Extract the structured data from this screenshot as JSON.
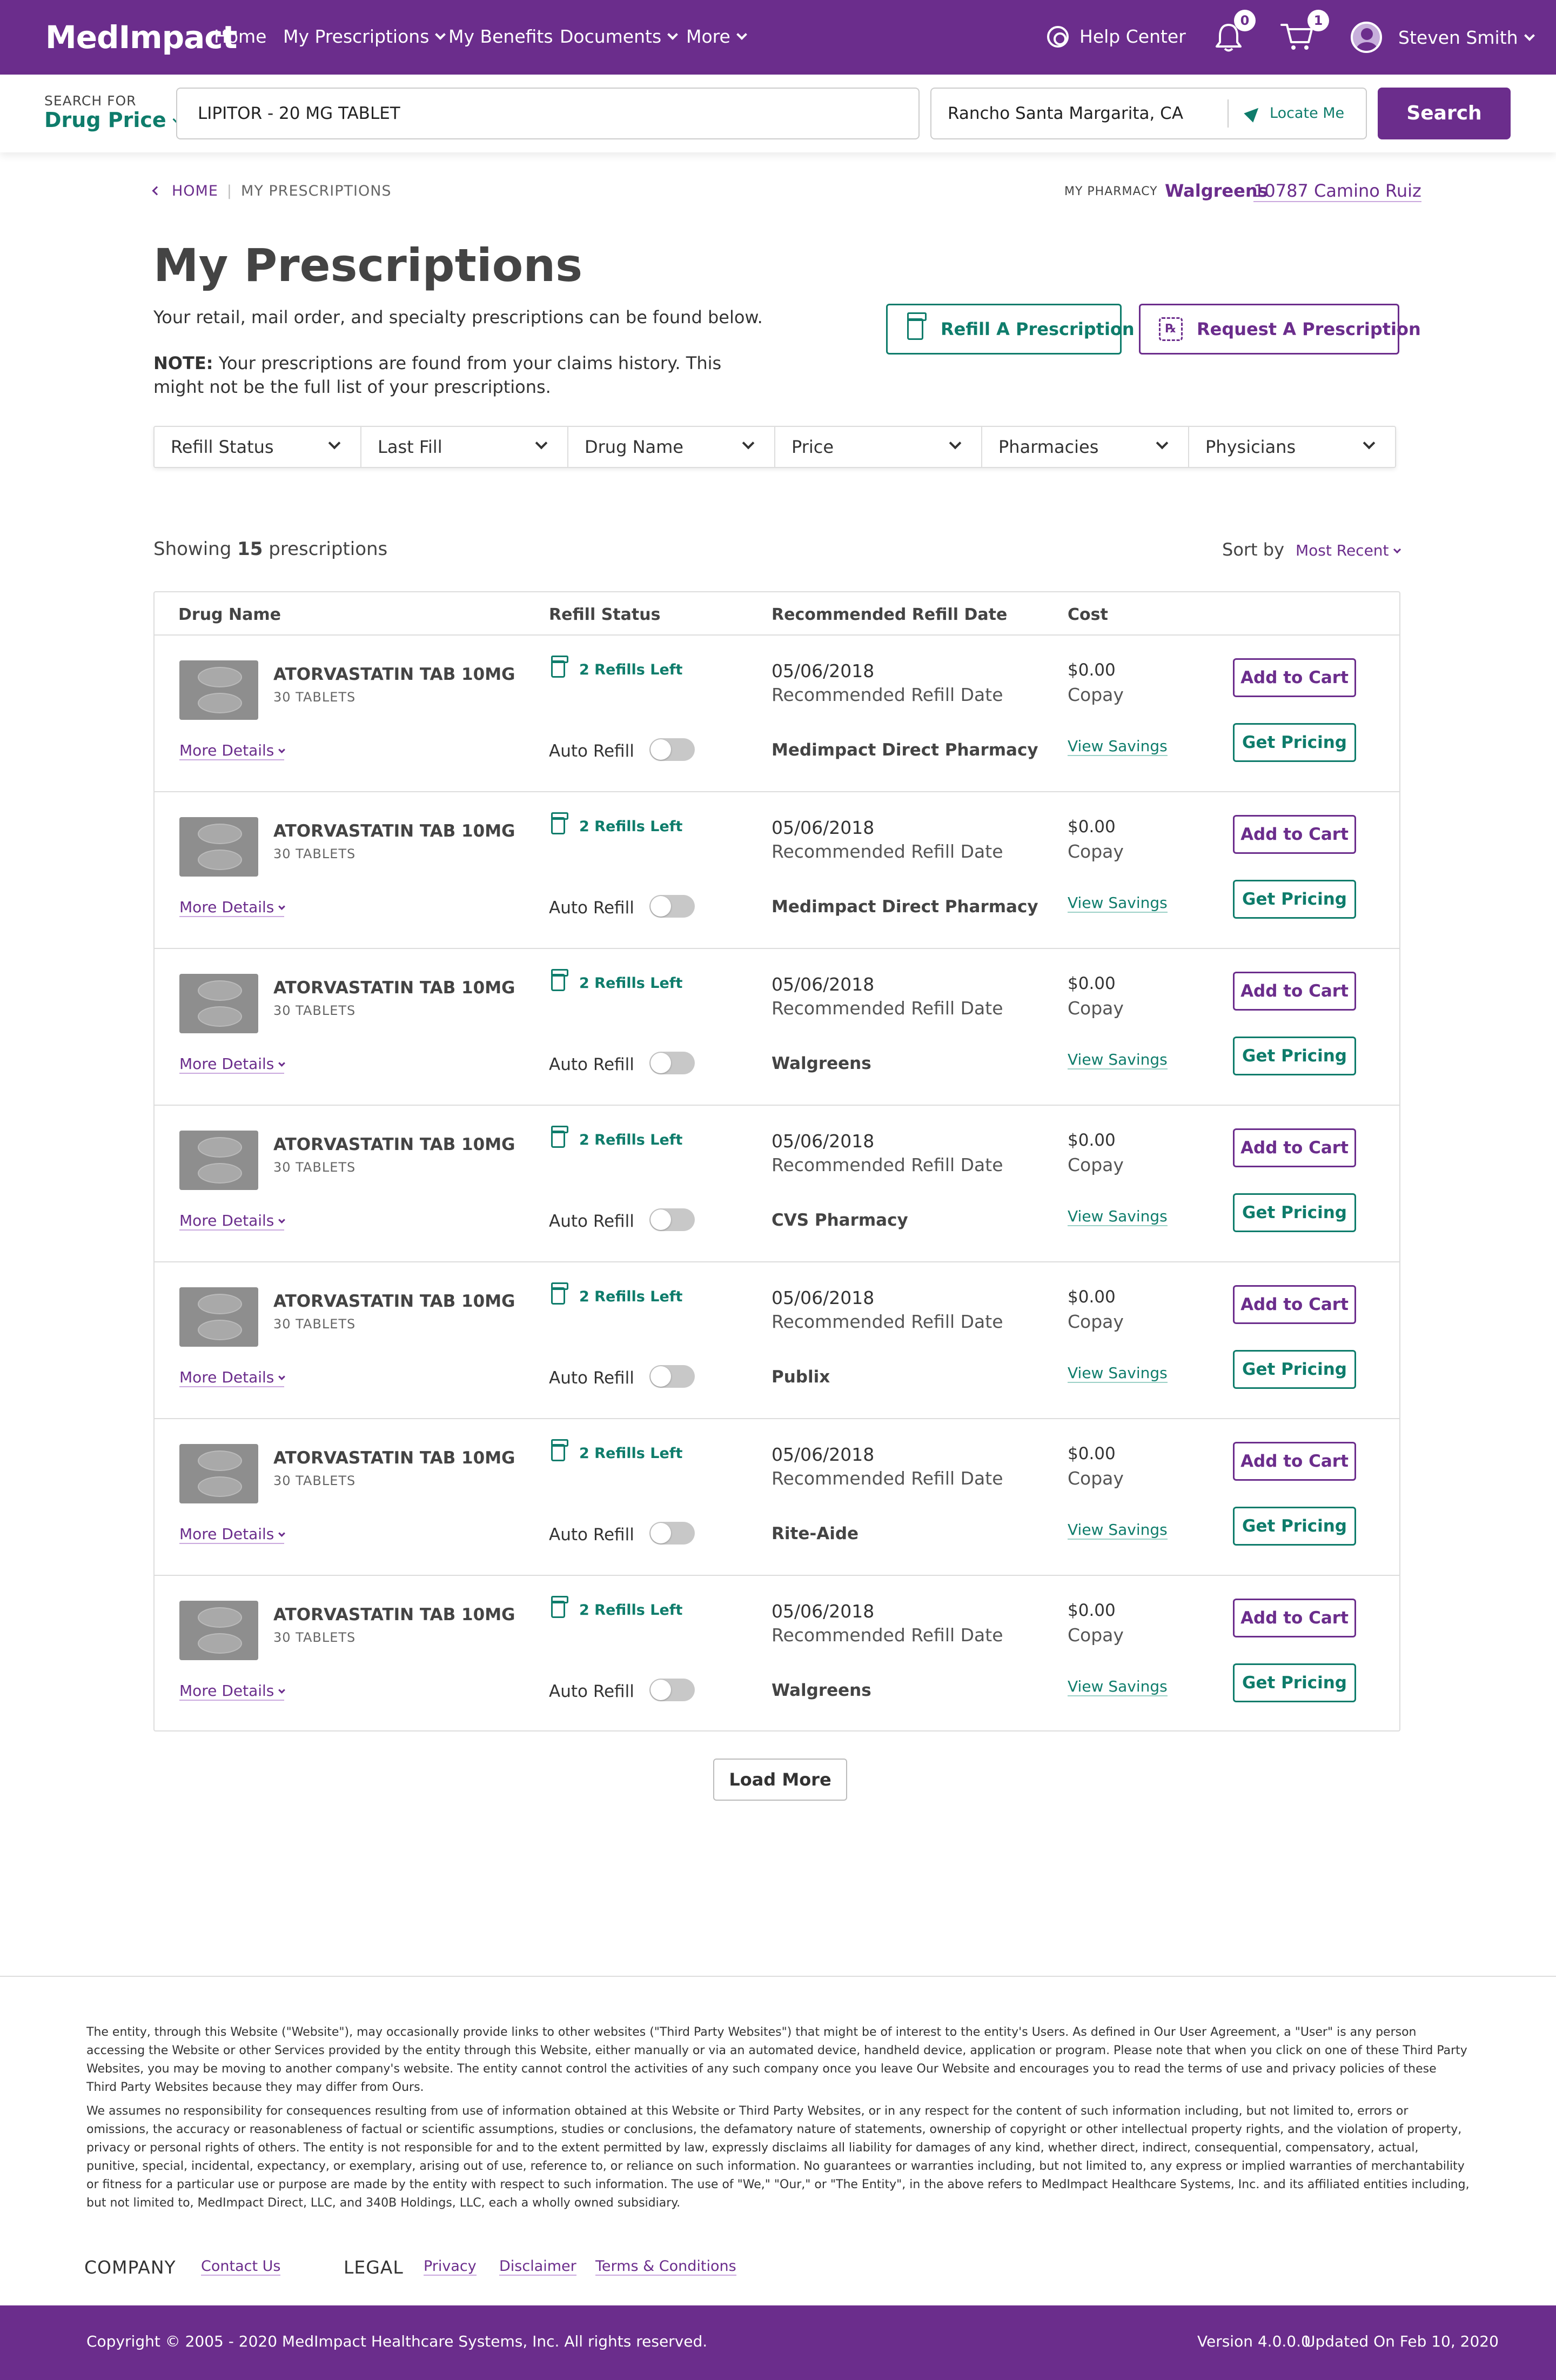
{
  "header": {
    "logo": "MedImpact",
    "nav": [
      "Home",
      "My Prescriptions",
      "My Benefits",
      "Documents",
      "More"
    ],
    "help_center": "Help Center",
    "notifications_count": "0",
    "cart_count": "1",
    "user_name": "Steven Smith"
  },
  "search": {
    "for_label": "SEARCH FOR",
    "for_value": "Drug Price",
    "drug_value": "LIPITOR - 20 MG TABLET",
    "location_value": "Rancho Santa Margarita, CA",
    "locate_me": "Locate Me",
    "button": "Search"
  },
  "breadcrumb": {
    "home": "HOME",
    "current": "MY PRESCRIPTIONS"
  },
  "pharmacy": {
    "label": "MY PHARMACY",
    "name": "Walgreens",
    "address": "10787 Camino Ruiz"
  },
  "page": {
    "title": "My Prescriptions",
    "intro": "Your retail, mail order, and specialty prescriptions can be found below.",
    "note_label": "NOTE:",
    "note_text": "Your prescriptions are found from your claims history. This might not be the full list of your prescriptions.",
    "refill_button": "Refill A Prescription",
    "request_button": "Request A Prescription",
    "rx_glyph": "℞"
  },
  "filters": [
    "Refill Status",
    "Last Fill",
    "Drug Name",
    "Price",
    "Pharmacies",
    "Physicians"
  ],
  "results": {
    "showing_prefix": "Showing",
    "count": "15",
    "showing_suffix": "prescriptions",
    "sort_label": "Sort by",
    "sort_value": "Most Recent"
  },
  "table": {
    "headers": {
      "drug": "Drug Name",
      "status": "Refill Status",
      "date": "Recommended Refill Date",
      "cost": "Cost"
    },
    "rows": [
      {
        "drug": "ATORVASTATIN TAB 10MG",
        "qty": "30 TABLETS",
        "more": "More Details",
        "refills": "2 Refills Left",
        "auto": "Auto Refill",
        "date": "05/06/2018",
        "date_label": "Recommended Refill Date",
        "pharmacy": "Medimpact Direct Pharmacy",
        "cost": "$0.00",
        "copay": "Copay",
        "savings": "View Savings",
        "cart": "Add to Cart",
        "pricing": "Get Pricing"
      },
      {
        "drug": "ATORVASTATIN TAB 10MG",
        "qty": "30 TABLETS",
        "more": "More Details",
        "refills": "2 Refills Left",
        "auto": "Auto Refill",
        "date": "05/06/2018",
        "date_label": "Recommended Refill Date",
        "pharmacy": "Medimpact Direct Pharmacy",
        "cost": "$0.00",
        "copay": "Copay",
        "savings": "View Savings",
        "cart": "Add to Cart",
        "pricing": "Get Pricing"
      },
      {
        "drug": "ATORVASTATIN TAB 10MG",
        "qty": "30 TABLETS",
        "more": "More Details",
        "refills": "2 Refills Left",
        "auto": "Auto Refill",
        "date": "05/06/2018",
        "date_label": "Recommended Refill Date",
        "pharmacy": "Walgreens",
        "cost": "$0.00",
        "copay": "Copay",
        "savings": "View Savings",
        "cart": "Add to Cart",
        "pricing": "Get Pricing"
      },
      {
        "drug": "ATORVASTATIN TAB 10MG",
        "qty": "30 TABLETS",
        "more": "More Details",
        "refills": "2 Refills Left",
        "auto": "Auto Refill",
        "date": "05/06/2018",
        "date_label": "Recommended Refill Date",
        "pharmacy": "CVS Pharmacy",
        "cost": "$0.00",
        "copay": "Copay",
        "savings": "View Savings",
        "cart": "Add to Cart",
        "pricing": "Get Pricing"
      },
      {
        "drug": "ATORVASTATIN TAB 10MG",
        "qty": "30 TABLETS",
        "more": "More Details",
        "refills": "2 Refills Left",
        "auto": "Auto Refill",
        "date": "05/06/2018",
        "date_label": "Recommended Refill Date",
        "pharmacy": "Publix",
        "cost": "$0.00",
        "copay": "Copay",
        "savings": "View Savings",
        "cart": "Add to Cart",
        "pricing": "Get Pricing"
      },
      {
        "drug": "ATORVASTATIN TAB 10MG",
        "qty": "30 TABLETS",
        "more": "More Details",
        "refills": "2 Refills Left",
        "auto": "Auto Refill",
        "date": "05/06/2018",
        "date_label": "Recommended Refill Date",
        "pharmacy": "Rite-Aide",
        "cost": "$0.00",
        "copay": "Copay",
        "savings": "View Savings",
        "cart": "Add to Cart",
        "pricing": "Get Pricing"
      },
      {
        "drug": "ATORVASTATIN TAB 10MG",
        "qty": "30 TABLETS",
        "more": "More Details",
        "refills": "2 Refills Left",
        "auto": "Auto Refill",
        "date": "05/06/2018",
        "date_label": "Recommended Refill Date",
        "pharmacy": "Walgreens",
        "cost": "$0.00",
        "copay": "Copay",
        "savings": "View Savings",
        "cart": "Add to Cart",
        "pricing": "Get Pricing"
      }
    ]
  },
  "load_more": "Load More",
  "footer": {
    "paragraph1": "The entity, through this Website (\"Website\"), may occasionally provide links to other websites (\"Third Party Websites\") that might be of interest to the entity's Users. As defined in Our User Agreement, a \"User\" is any person accessing the Website or other Services provided by the entity through this Website, either manually or via an automated device, handheld device, application or program. Please note that when you click on one of these Third Party Websites, you may be moving to another company's website. The entity cannot control the activities of any such company once you leave Our Website and encourages you to read the terms of use and privacy policies of these Third Party Websites because they may differ from Ours.",
    "paragraph2": "We assumes no responsibility for consequences resulting from use of information obtained at this Website or Third Party Websites, or in any respect for the content of such information including, but not limited to, errors or omissions, the accuracy or reasonableness of factual or scientific assumptions, studies or conclusions, the defamatory nature of statements, ownership of copyright or other intellectual property rights, and the violation of property, privacy or personal rights of others. The entity is not responsible for and to the extent permitted by law, expressly disclaims all liability for damages of any kind, whether direct, indirect, consequential, compensatory, actual, punitive, special, incidental, expectancy, or exemplary, arising out of use, reference to, or reliance on such information. No guarantees or warranties including, but not limited to, any express or implied warranties of merchantability or fitness for a particular use or purpose are made by the entity with respect to such information. The use of \"We,\" \"Our,\" or \"The Entity\", in the above refers to MedImpact Healthcare Systems, Inc. and its affiliated entities including, but not limited to, MedImpact Direct, LLC, and 340B Holdings, LLC, each a wholly owned subsidiary.",
    "company_label": "COMPANY",
    "contact": "Contact Us",
    "legal_label": "LEGAL",
    "privacy": "Privacy",
    "disclaimer": "Disclaimer",
    "terms": "Terms & Conditions",
    "copyright": "Copyright © 2005 - 2020 MedImpact Healthcare Systems, Inc. All rights reserved.",
    "version": "Version 4.0.0.0",
    "updated": "Updated On Feb 10, 2020"
  },
  "colors": {
    "brand_purple": "#6b2d8c",
    "accent_teal": "#0e7c6b"
  }
}
